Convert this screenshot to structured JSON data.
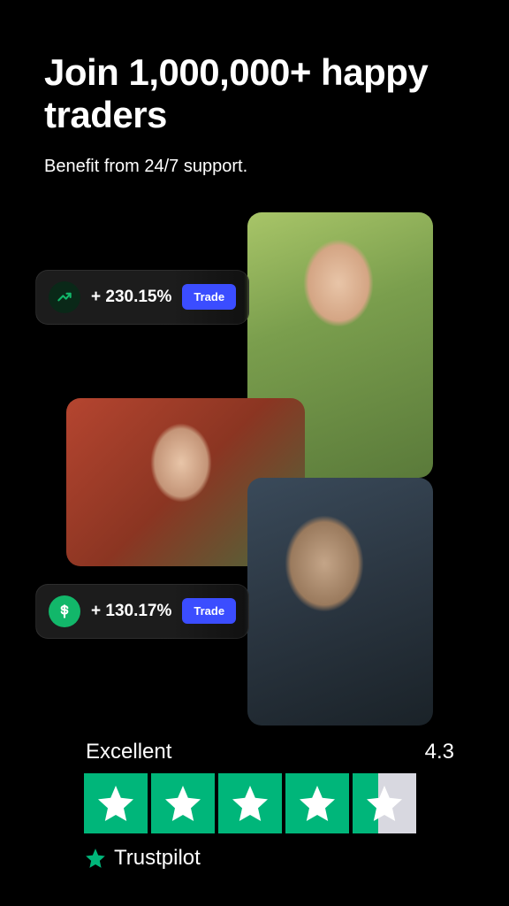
{
  "heading": "Join 1,000,000+ happy traders",
  "subheading": "Benefit from 24/7 support.",
  "pills": [
    {
      "icon": "trend-up",
      "value": "+ 230.15%",
      "button": "Trade"
    },
    {
      "icon": "dollar",
      "value": "+ 130.17%",
      "button": "Trade"
    }
  ],
  "trustpilot": {
    "label": "Excellent",
    "score": "4.3",
    "brand": "Trustpilot",
    "stars_full": 4,
    "stars_partial_fraction": 0.4
  },
  "colors": {
    "accent_button": "#3b4dff",
    "trustpilot_green": "#00b67a",
    "dollar_icon_bg": "#12b76a"
  }
}
